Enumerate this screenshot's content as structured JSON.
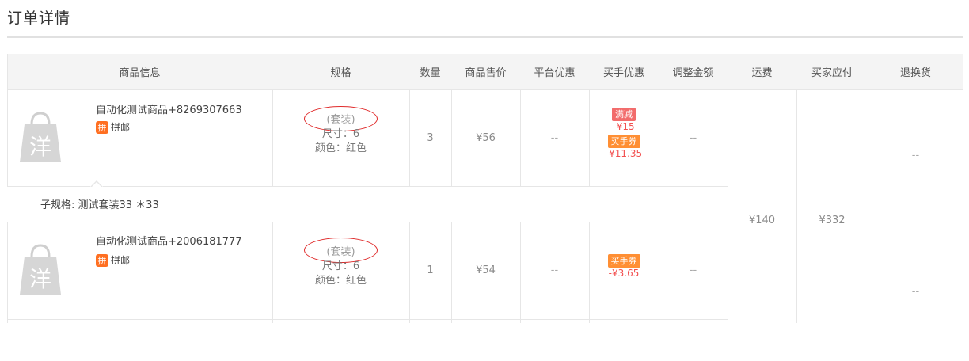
{
  "page": {
    "title": "订单详情"
  },
  "table": {
    "headers": {
      "product_info": "商品信息",
      "spec": "规格",
      "quantity": "数量",
      "price": "商品售价",
      "platform_discount": "平台优惠",
      "buyer_discount": "买手优惠",
      "adjust_amount": "调整金额",
      "shipping": "运费",
      "buyer_payable": "买家应付",
      "return_exchange": "退换货"
    },
    "rows": [
      {
        "product_name": "自动化测试商品+8269307663",
        "tag_icon": "拼",
        "tag_label": "拼邮",
        "spec_kit": "(套装)",
        "spec_size": "尺寸：6",
        "spec_color": "颜色：红色",
        "quantity": "3",
        "price": "¥56",
        "platform_discount": "--",
        "discount_badge_1": "满减",
        "discount_value_1": "-¥15",
        "discount_badge_2": "买手券",
        "discount_value_2": "-¥11.35",
        "adjust_amount": "--",
        "return_exchange": "--"
      },
      {
        "product_name": "自动化测试商品+2006181777",
        "tag_icon": "拼",
        "tag_label": "拼邮",
        "spec_kit": "(套装)",
        "spec_size": "尺寸：6",
        "spec_color": "颜色：红色",
        "quantity": "1",
        "price": "¥54",
        "platform_discount": "--",
        "discount_badge_1": "买手券",
        "discount_value_1": "-¥3.65",
        "adjust_amount": "--",
        "return_exchange": "--"
      }
    ],
    "sub_spec": "子规格: 测试套装33 ＊33",
    "shipping": "¥140",
    "buyer_payable": "¥332"
  },
  "colors": {
    "header_bg": "#f4f4f4",
    "badge_red": "#f26c6c",
    "badge_orange": "#ff8f34",
    "discount_text": "#f24f4f",
    "annotation_oval": "#e02b2b"
  },
  "icons": {
    "product_thumb": "yang-shopping-bag-icon",
    "tag": "pin-tag-icon"
  }
}
